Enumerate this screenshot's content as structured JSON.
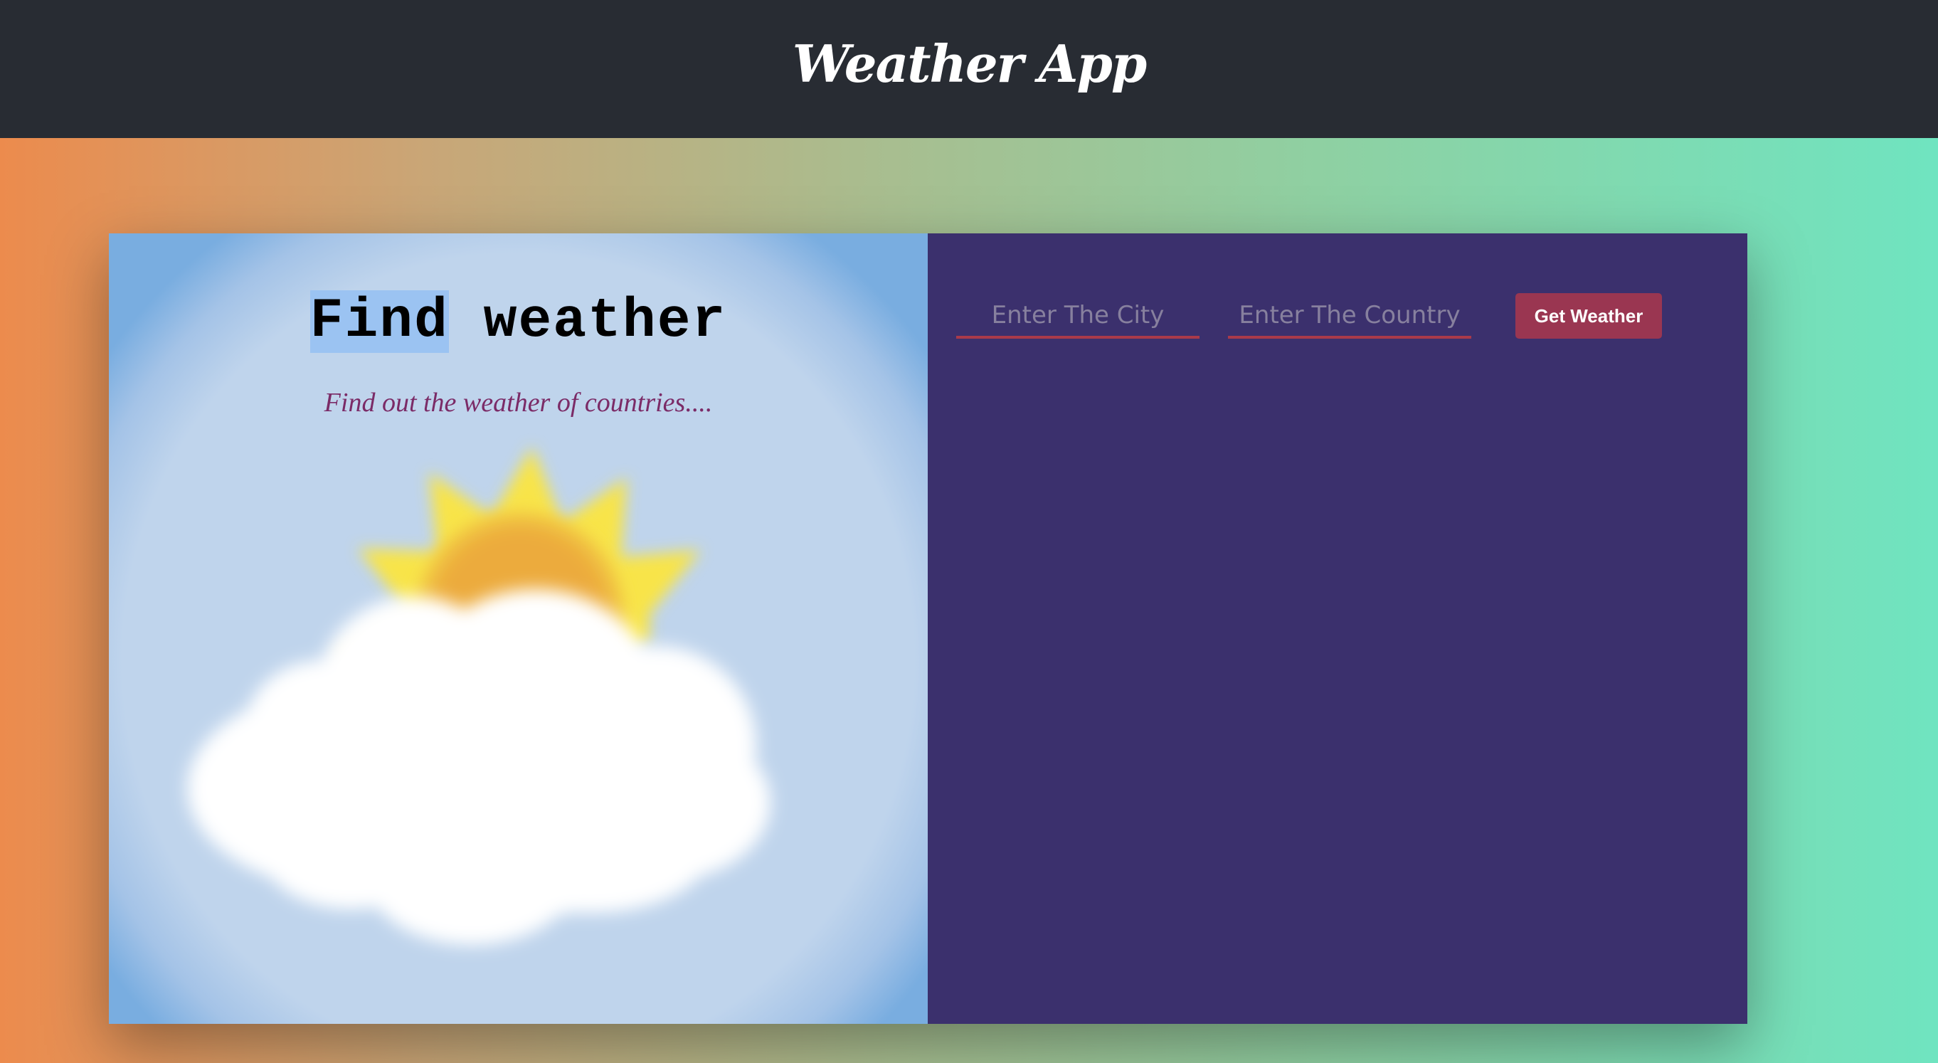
{
  "header": {
    "app_title": "Weather App"
  },
  "left_panel": {
    "title_highlight": "Find",
    "title_rest": " weather",
    "subtitle": "Find out the weather of countries...."
  },
  "form": {
    "city_placeholder": "Enter The City",
    "country_placeholder": "Enter The Country",
    "submit_label": "Get Weather"
  },
  "colors": {
    "navbar": "#282c33",
    "form_panel": "#3b306d",
    "button": "#9a3651",
    "input_underline": "#a93a4a",
    "subtitle": "#7b2b67"
  },
  "icons": {
    "illustration": "sun-behind-cloud-icon"
  }
}
